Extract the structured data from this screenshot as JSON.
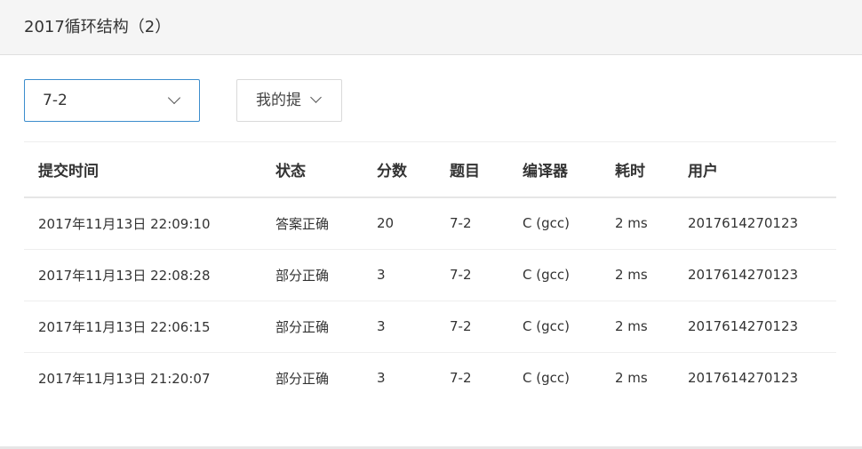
{
  "header": {
    "title": "2017循环结构（2）"
  },
  "filters": {
    "problem_select": {
      "value": "7-2"
    },
    "owner_select": {
      "value": "我的提"
    }
  },
  "table": {
    "columns": [
      "提交时间",
      "状态",
      "分数",
      "题目",
      "编译器",
      "耗时",
      "用户"
    ],
    "rows": [
      {
        "time": "2017年11月13日 22:09:10",
        "status": "答案正确",
        "score": "20",
        "problem": "7-2",
        "compiler": "C (gcc)",
        "elapsed": "2 ms",
        "user": "2017614270123"
      },
      {
        "time": "2017年11月13日 22:08:28",
        "status": "部分正确",
        "score": "3",
        "problem": "7-2",
        "compiler": "C (gcc)",
        "elapsed": "2 ms",
        "user": "2017614270123"
      },
      {
        "time": "2017年11月13日 22:06:15",
        "status": "部分正确",
        "score": "3",
        "problem": "7-2",
        "compiler": "C (gcc)",
        "elapsed": "2 ms",
        "user": "2017614270123"
      },
      {
        "time": "2017年11月13日 21:20:07",
        "status": "部分正确",
        "score": "3",
        "problem": "7-2",
        "compiler": "C (gcc)",
        "elapsed": "2 ms",
        "user": "2017614270123"
      }
    ]
  },
  "colors": {
    "accepted": "#d9534f",
    "partial": "#5cb85c",
    "link": "#2a5a8a",
    "focus_border": "#3c8dcd"
  }
}
